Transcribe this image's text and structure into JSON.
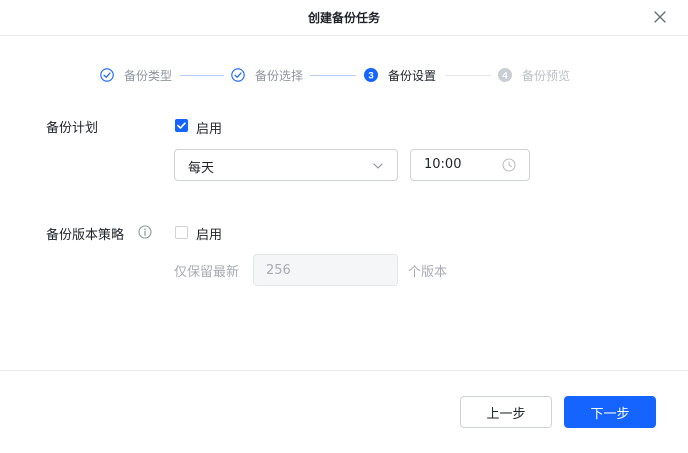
{
  "dialog": {
    "title": "创建备份任务"
  },
  "steps": [
    {
      "label": "备份类型",
      "status": "done"
    },
    {
      "label": "备份选择",
      "status": "done"
    },
    {
      "label": "备份设置",
      "status": "current",
      "number": "3"
    },
    {
      "label": "备份预览",
      "status": "todo",
      "number": "4"
    }
  ],
  "schedule": {
    "label": "备份计划",
    "enable_label": "启用",
    "enabled": true,
    "frequency": "每天",
    "time": "10:00"
  },
  "versioning": {
    "label": "备份版本策略",
    "enable_label": "启用",
    "enabled": false,
    "keep_prefix": "仅保留最新",
    "keep_count": "256",
    "keep_suffix": "个版本"
  },
  "footer": {
    "prev_label": "上一步",
    "next_label": "下一步"
  },
  "colors": {
    "primary": "#1664ff",
    "border": "#d0d3d6",
    "muted": "#a8abb0"
  }
}
